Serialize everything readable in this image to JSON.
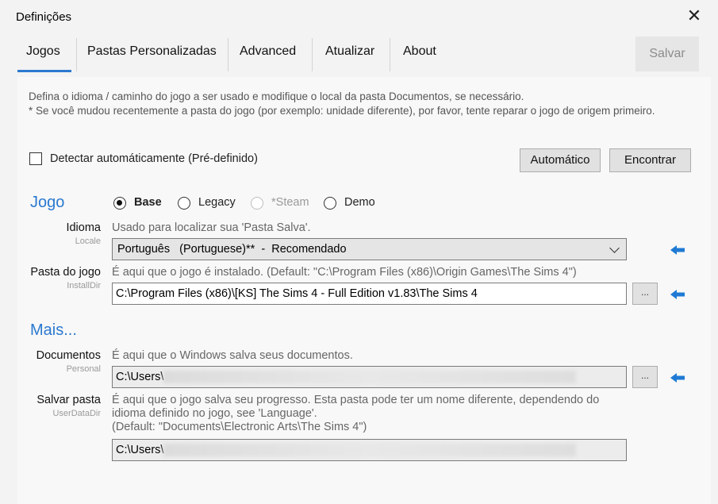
{
  "window": {
    "title": "Definições",
    "close_glyph": "✕"
  },
  "tabs": [
    {
      "label": "Jogos",
      "active": true
    },
    {
      "label": "Pastas Personalizadas"
    },
    {
      "label": "Advanced"
    },
    {
      "label": "Atualizar"
    },
    {
      "label": "About"
    }
  ],
  "toolbar": {
    "save_label": "Salvar"
  },
  "description": {
    "line1": "Defina o idioma / caminho do jogo a ser usado e modifique o local da pasta Documentos, se necessário.",
    "line2": "* Se você mudou recentemente a pasta do jogo (por exemplo: unidade diferente), por favor, tente reparar o jogo de origem primeiro."
  },
  "auto_detect": {
    "label": "Detectar automáticamente (Pré-definido)",
    "checked": false
  },
  "buttons": {
    "auto": "Automático",
    "find": "Encontrar"
  },
  "game_section": {
    "title": "Jogo",
    "radios": [
      {
        "label": "Base",
        "selected": true,
        "disabled": false
      },
      {
        "label": "Legacy",
        "selected": false,
        "disabled": false
      },
      {
        "label": "*Steam",
        "selected": false,
        "disabled": true
      },
      {
        "label": "Demo",
        "selected": false,
        "disabled": false
      }
    ]
  },
  "language": {
    "label": "Idioma",
    "key": "Locale",
    "hint": "Usado para localizar sua 'Pasta Salva'.",
    "value": "Português   (Portuguese)**  -  Recomendado"
  },
  "install_dir": {
    "label": "Pasta do jogo",
    "key": "InstallDir",
    "hint": "É aqui que o jogo é instalado.  (Default: \"C:\\Program Files (x86)\\Origin Games\\The Sims 4\")",
    "value": "C:\\Program Files (x86)\\[KS] The Sims 4 - Full Edition v1.83\\The Sims 4",
    "browse": "..."
  },
  "more_section": {
    "title": "Mais..."
  },
  "documents": {
    "label": "Documentos",
    "key": "Personal",
    "hint": "É aqui que o Windows salva seus documentos.",
    "value": "C:\\Users\\",
    "browse": "..."
  },
  "save_folder": {
    "label": "Salvar pasta",
    "key": "UserDataDir",
    "hint_line1": "É aqui que o jogo salva seu progresso. Esta pasta pode ter um nome diferente, dependendo do",
    "hint_line2": "idioma definido no jogo, see 'Language'.",
    "hint_line3": "(Default: \"Documents\\Electronic Arts\\The Sims 4\")",
    "value": "C:\\Users\\"
  },
  "colors": {
    "accent": "#2b79d0",
    "arrow": "#1e7ad4"
  },
  "icons": {
    "arrow": "arrow-left-icon",
    "close": "close-icon",
    "dropdown": "chevron-down-icon"
  }
}
